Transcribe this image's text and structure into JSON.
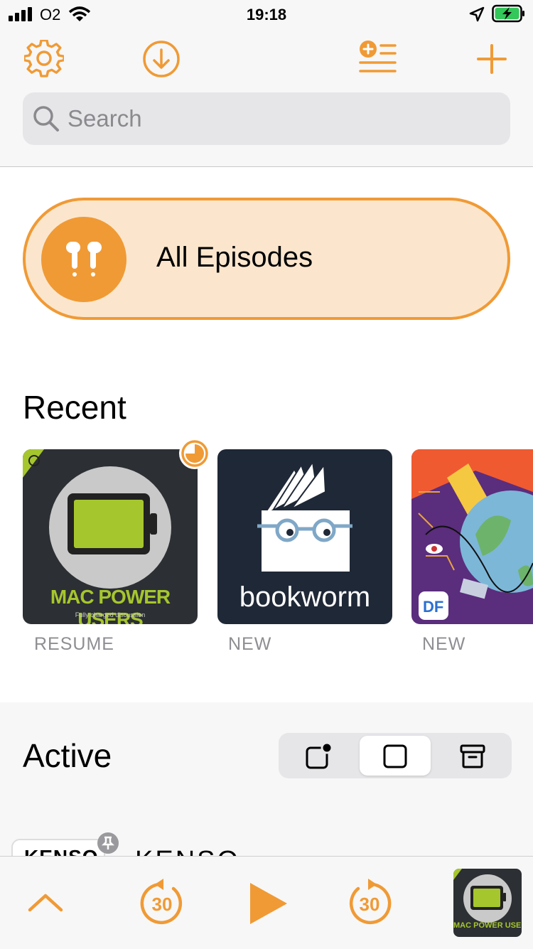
{
  "status": {
    "carrier": "O2",
    "time": "19:18"
  },
  "toolbar": {
    "settings_icon": "gear-icon",
    "download_icon": "download-icon",
    "queue_icon": "add-queue-icon",
    "add_icon": "plus-icon"
  },
  "search": {
    "placeholder": "Search"
  },
  "all_episodes": {
    "label": "All Episodes",
    "icon": "airpods-icon"
  },
  "recent": {
    "title": "Recent",
    "items": [
      {
        "status": "RESUME",
        "artwork_title": "MAC POWER USERS",
        "artwork_subtitle": "Fully charged discussion"
      },
      {
        "status": "NEW",
        "artwork_title": "bookworm"
      },
      {
        "status": "NEW",
        "artwork_badge": "DF"
      }
    ]
  },
  "active": {
    "title": "Active",
    "segments": [
      "new-icon",
      "square-icon",
      "archive-icon"
    ],
    "selected_index": 1
  },
  "partial_row": {
    "badge": "KENSO",
    "title": "KENSO"
  },
  "player": {
    "skip_back": "30",
    "skip_forward": "30",
    "artwork_title": "MAC POWER USERS"
  },
  "colors": {
    "accent": "#f09a35",
    "pill_fill": "#fbe6cd",
    "mpu_green": "#a6c62d",
    "bookworm_bg": "#1f2836"
  }
}
